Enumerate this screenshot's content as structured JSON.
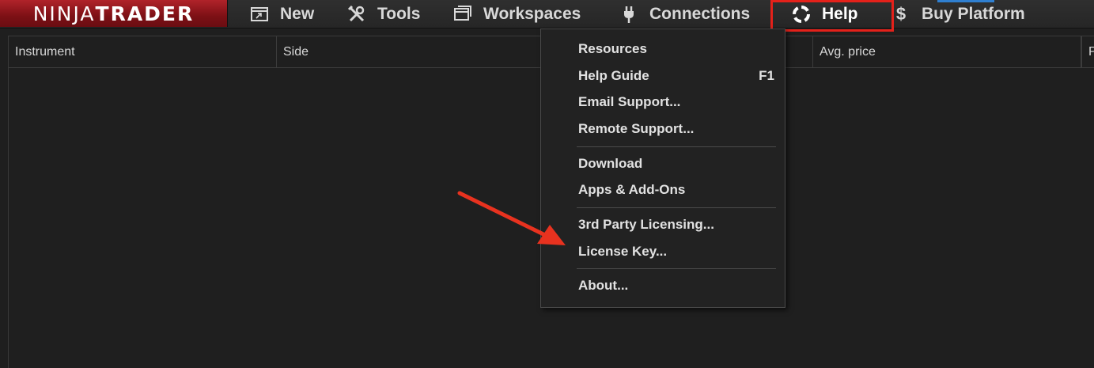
{
  "logo": {
    "part1": "NINJA",
    "part2": "TRADER"
  },
  "menu": {
    "new": "New",
    "tools": "Tools",
    "workspaces": "Workspaces",
    "connections": "Connections",
    "help": "Help",
    "buy": "Buy Platform"
  },
  "grid": {
    "columns": [
      "Instrument",
      "Side",
      "Avg. price",
      "P"
    ]
  },
  "help_menu": {
    "items": [
      {
        "label": "Resources",
        "shortcut": ""
      },
      {
        "label": "Help Guide",
        "shortcut": "F1"
      },
      {
        "label": "Email Support...",
        "shortcut": ""
      },
      {
        "label": "Remote Support...",
        "shortcut": ""
      },
      {
        "label": "Download",
        "shortcut": ""
      },
      {
        "label": "Apps & Add-Ons",
        "shortcut": ""
      },
      {
        "label": "3rd Party Licensing...",
        "shortcut": ""
      },
      {
        "label": "License Key...",
        "shortcut": ""
      },
      {
        "label": "About...",
        "shortcut": ""
      }
    ]
  },
  "colors": {
    "highlight": "#e4211a",
    "arrow": "#e8321f",
    "logo_red": "#9a1a20"
  }
}
